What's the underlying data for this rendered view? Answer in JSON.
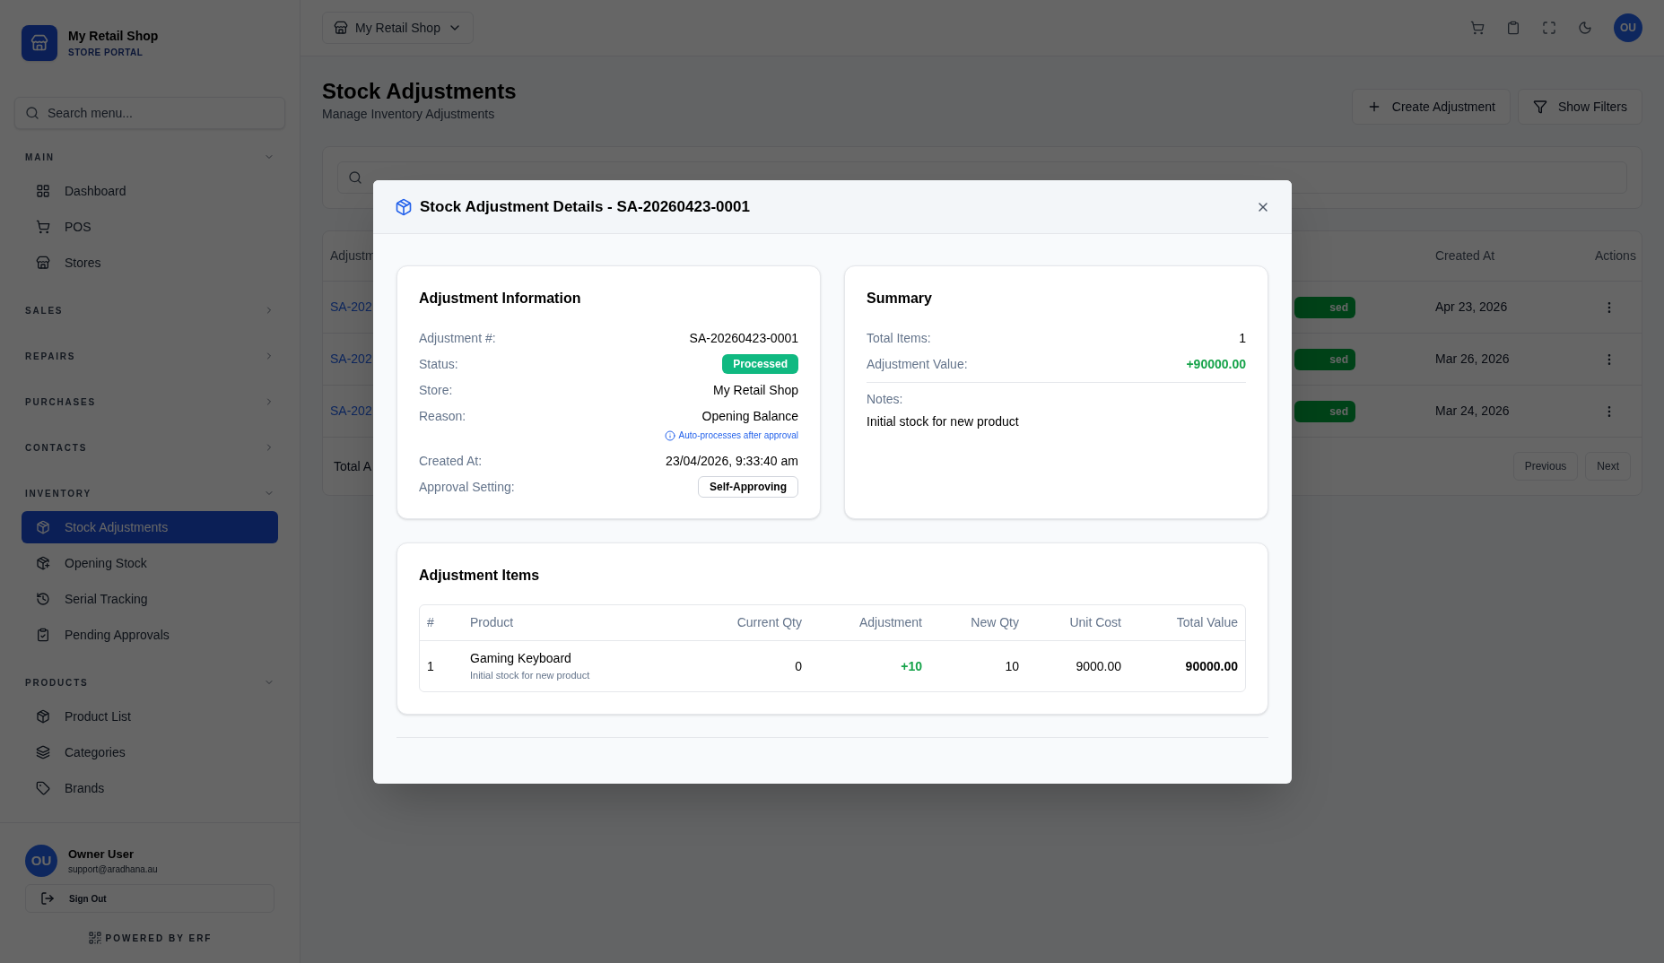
{
  "brand": {
    "name": "My Retail Shop",
    "subtitle": "STORE PORTAL"
  },
  "sidebar": {
    "search_placeholder": "Search menu...",
    "sections": [
      {
        "title": "MAIN",
        "expanded": true,
        "items": [
          {
            "label": "Dashboard",
            "selected": false
          },
          {
            "label": "POS",
            "selected": false
          },
          {
            "label": "Stores",
            "selected": false
          }
        ]
      },
      {
        "title": "SALES",
        "expanded": false
      },
      {
        "title": "REPAIRS",
        "expanded": false
      },
      {
        "title": "PURCHASES",
        "expanded": false
      },
      {
        "title": "CONTACTS",
        "expanded": false
      },
      {
        "title": "INVENTORY",
        "expanded": true,
        "items": [
          {
            "label": "Stock Adjustments",
            "selected": true
          },
          {
            "label": "Opening Stock",
            "selected": false
          },
          {
            "label": "Serial Tracking",
            "selected": false
          },
          {
            "label": "Pending Approvals",
            "selected": false
          }
        ]
      },
      {
        "title": "PRODUCTS",
        "expanded": true,
        "items": [
          {
            "label": "Product List",
            "selected": false
          },
          {
            "label": "Categories",
            "selected": false
          },
          {
            "label": "Brands",
            "selected": false
          }
        ]
      }
    ],
    "user": {
      "initials": "OU",
      "name": "Owner User",
      "email": "support@aradhana.au"
    },
    "sign_out": "Sign Out",
    "powered_by": "POWERED BY ERF"
  },
  "topbar": {
    "store_selector": "My Retail Shop",
    "avatar": "OU"
  },
  "page": {
    "title": "Stock Adjustments",
    "subtitle": "Manage Inventory Adjustments",
    "buttons": [
      "Create Adjustment",
      "Show Filters"
    ],
    "table": {
      "columns": [
        "Adjustm",
        "Created At",
        "Actions"
      ],
      "rows": [
        {
          "id": "SA-202",
          "status": "sed",
          "created_at": "Apr 23, 2026"
        },
        {
          "id": "SA-202",
          "status": "sed",
          "created_at": "Mar 26, 2026"
        },
        {
          "id": "SA-202",
          "status": "sed",
          "created_at": "Mar 24, 2026"
        }
      ],
      "footer": "Total A",
      "pagination": [
        "Previous",
        "Next"
      ]
    }
  },
  "modal": {
    "title": "Stock Adjustment Details - SA-20260423-0001",
    "info": {
      "title": "Adjustment Information",
      "fields": [
        {
          "label": "Adjustment #:",
          "value": "SA-20260423-0001",
          "kind": "text"
        },
        {
          "label": "Status:",
          "value": "Processed",
          "kind": "badge"
        },
        {
          "label": "Store:",
          "value": "My Retail Shop",
          "kind": "text"
        },
        {
          "label": "Reason:",
          "value": "Opening Balance",
          "kind": "text",
          "note": "Auto-processes after approval"
        },
        {
          "label": "Created At:",
          "value": "23/04/2026, 9:33:40 am",
          "kind": "text"
        },
        {
          "label": "Approval Setting:",
          "value": "Self-Approving",
          "kind": "tag"
        }
      ]
    },
    "summary": {
      "title": "Summary",
      "fields": [
        {
          "label": "Total Items:",
          "value": "1",
          "kind": "text"
        },
        {
          "label": "Adjustment Value:",
          "value": "+90000.00",
          "kind": "positive"
        }
      ],
      "notes_label": "Notes:",
      "notes": "Initial stock for new product"
    },
    "items": {
      "title": "Adjustment Items",
      "columns": [
        "#",
        "Product",
        "Current Qty",
        "Adjustment",
        "New Qty",
        "Unit Cost",
        "Total Value"
      ],
      "rows": [
        {
          "index": "1",
          "product": "Gaming Keyboard",
          "note": "Initial stock for new product",
          "current_qty": "0",
          "adjustment": "+10",
          "new_qty": "10",
          "unit_cost": "9000.00",
          "total_value": "90000.00"
        }
      ]
    }
  }
}
